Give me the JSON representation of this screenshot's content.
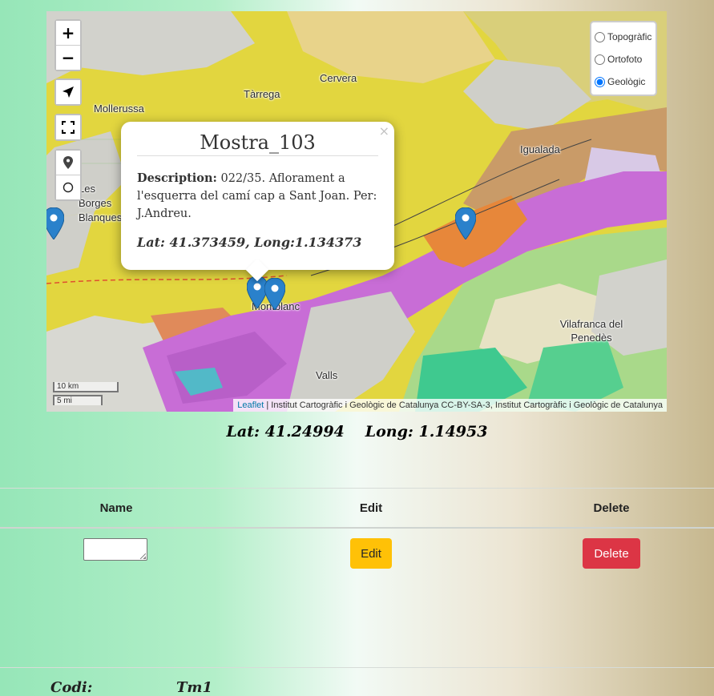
{
  "map": {
    "zoom_in_label": "+",
    "zoom_out_label": "−",
    "place_names": [
      "Cervera",
      "Tàrrega",
      "Mollerussa",
      "Igualada",
      "Les Borges Blanques",
      "Montblanc",
      "Valls",
      "Vilafranca del Penedès"
    ],
    "layers": [
      {
        "label": "Topogràfic",
        "checked": false
      },
      {
        "label": "Ortofoto",
        "checked": false
      },
      {
        "label": "Geològic",
        "checked": true
      }
    ],
    "scale_metric": "10 km",
    "scale_imperial": "5 mi",
    "attribution_link": "Leaflet",
    "attribution_text": " | Institut Cartogràfic i Geològic de Catalunya CC-BY-SA-3, Institut Cartogràfic i Geològic de Catalunya",
    "popup": {
      "close": "×",
      "title": "Mostra_103",
      "description_label": "Description:",
      "description_text": " 022/35. Aflorament a l'esquerra del camí cap a Sant Joan. Per: J.Andreu.",
      "coords": "Lat: 41.373459, Long:1.134373"
    },
    "colors": {
      "marker": "#2a81cb",
      "geology_yellow": "#e2d63f",
      "geology_magenta": "#c86dd6",
      "geology_orange": "#e7873a"
    }
  },
  "cursor": {
    "lat": "Lat: 41.24994",
    "long": "Long: 1.14953"
  },
  "table": {
    "headers": {
      "name": "Name",
      "edit": "Edit",
      "delete": "Delete"
    },
    "row": {
      "edit_label": "Edit",
      "delete_label": "Delete",
      "name_value": ""
    }
  },
  "detail": {
    "codi_label": "Codi:",
    "codi_value": "Tm1"
  }
}
